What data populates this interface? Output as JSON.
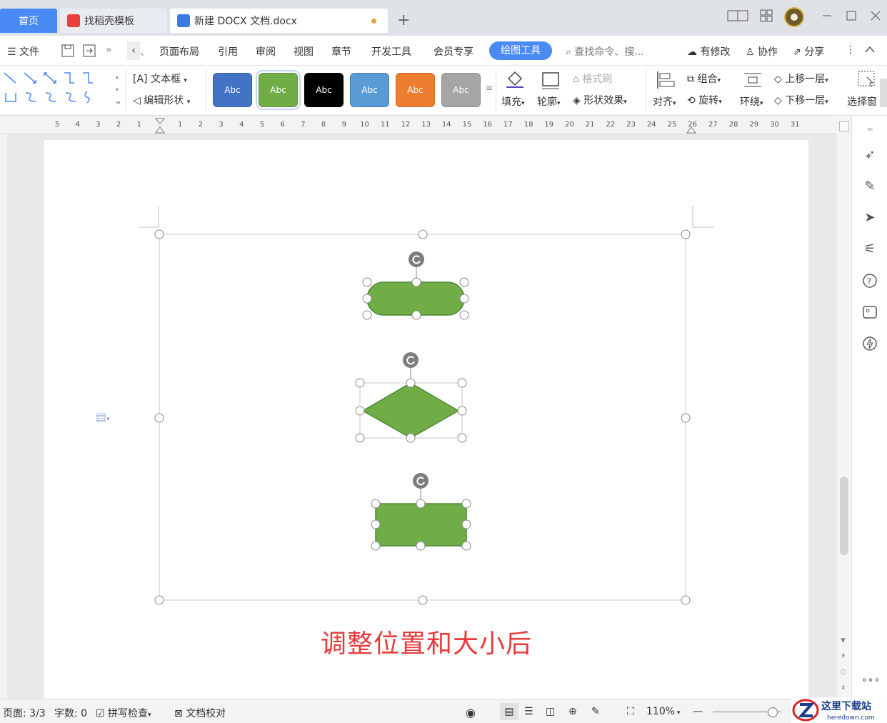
{
  "tabs": {
    "home": "首页",
    "template": "找稻壳模板",
    "document": "新建 DOCX 文档.docx"
  },
  "menu": {
    "file": "文件",
    "items": [
      "页面布局",
      "引用",
      "审阅",
      "视图",
      "章节",
      "开发工具",
      "会员专享"
    ],
    "active": "绘图工具",
    "search": "查找命令、搜...",
    "modified": "有修改",
    "collab": "协作",
    "share": "分享"
  },
  "ribbon": {
    "textbox": "文本框",
    "edit_shape": "编辑形状",
    "styles": [
      "Abc",
      "Abc",
      "Abc",
      "Abc",
      "Abc",
      "Abc"
    ],
    "style_colors": [
      "#4472c4",
      "#70ad47",
      "#000000",
      "#5b9bd5",
      "#ed7d31",
      "#a5a5a5"
    ],
    "fill": "填充",
    "outline": "轮廓",
    "format_brush": "格式刷",
    "shape_effect": "形状效果",
    "align": "对齐",
    "group": "组合",
    "rotate": "旋转",
    "wrap": "环绕",
    "bring_forward": "上移一层",
    "send_backward": "下移一层",
    "select_pane": "选择窗"
  },
  "ruler": {
    "numbers": [
      "5",
      "4",
      "3",
      "2",
      "1",
      "",
      "1",
      "2",
      "3",
      "4",
      "5",
      "6",
      "7",
      "8",
      "9",
      "10",
      "11",
      "12",
      "13",
      "14",
      "15",
      "16",
      "17",
      "18",
      "19",
      "20",
      "21",
      "22",
      "23",
      "24",
      "25",
      "26",
      "27",
      "28",
      "29",
      "30",
      "31"
    ]
  },
  "document": {
    "caption": "调整位置和大小后",
    "shape_color": "#70ad47",
    "shape_border": "#4e8a34"
  },
  "status": {
    "page": "页面: 3/3",
    "words": "字数: 0",
    "spell": "拼写检查",
    "proof": "文档校对",
    "zoom": "110%"
  }
}
